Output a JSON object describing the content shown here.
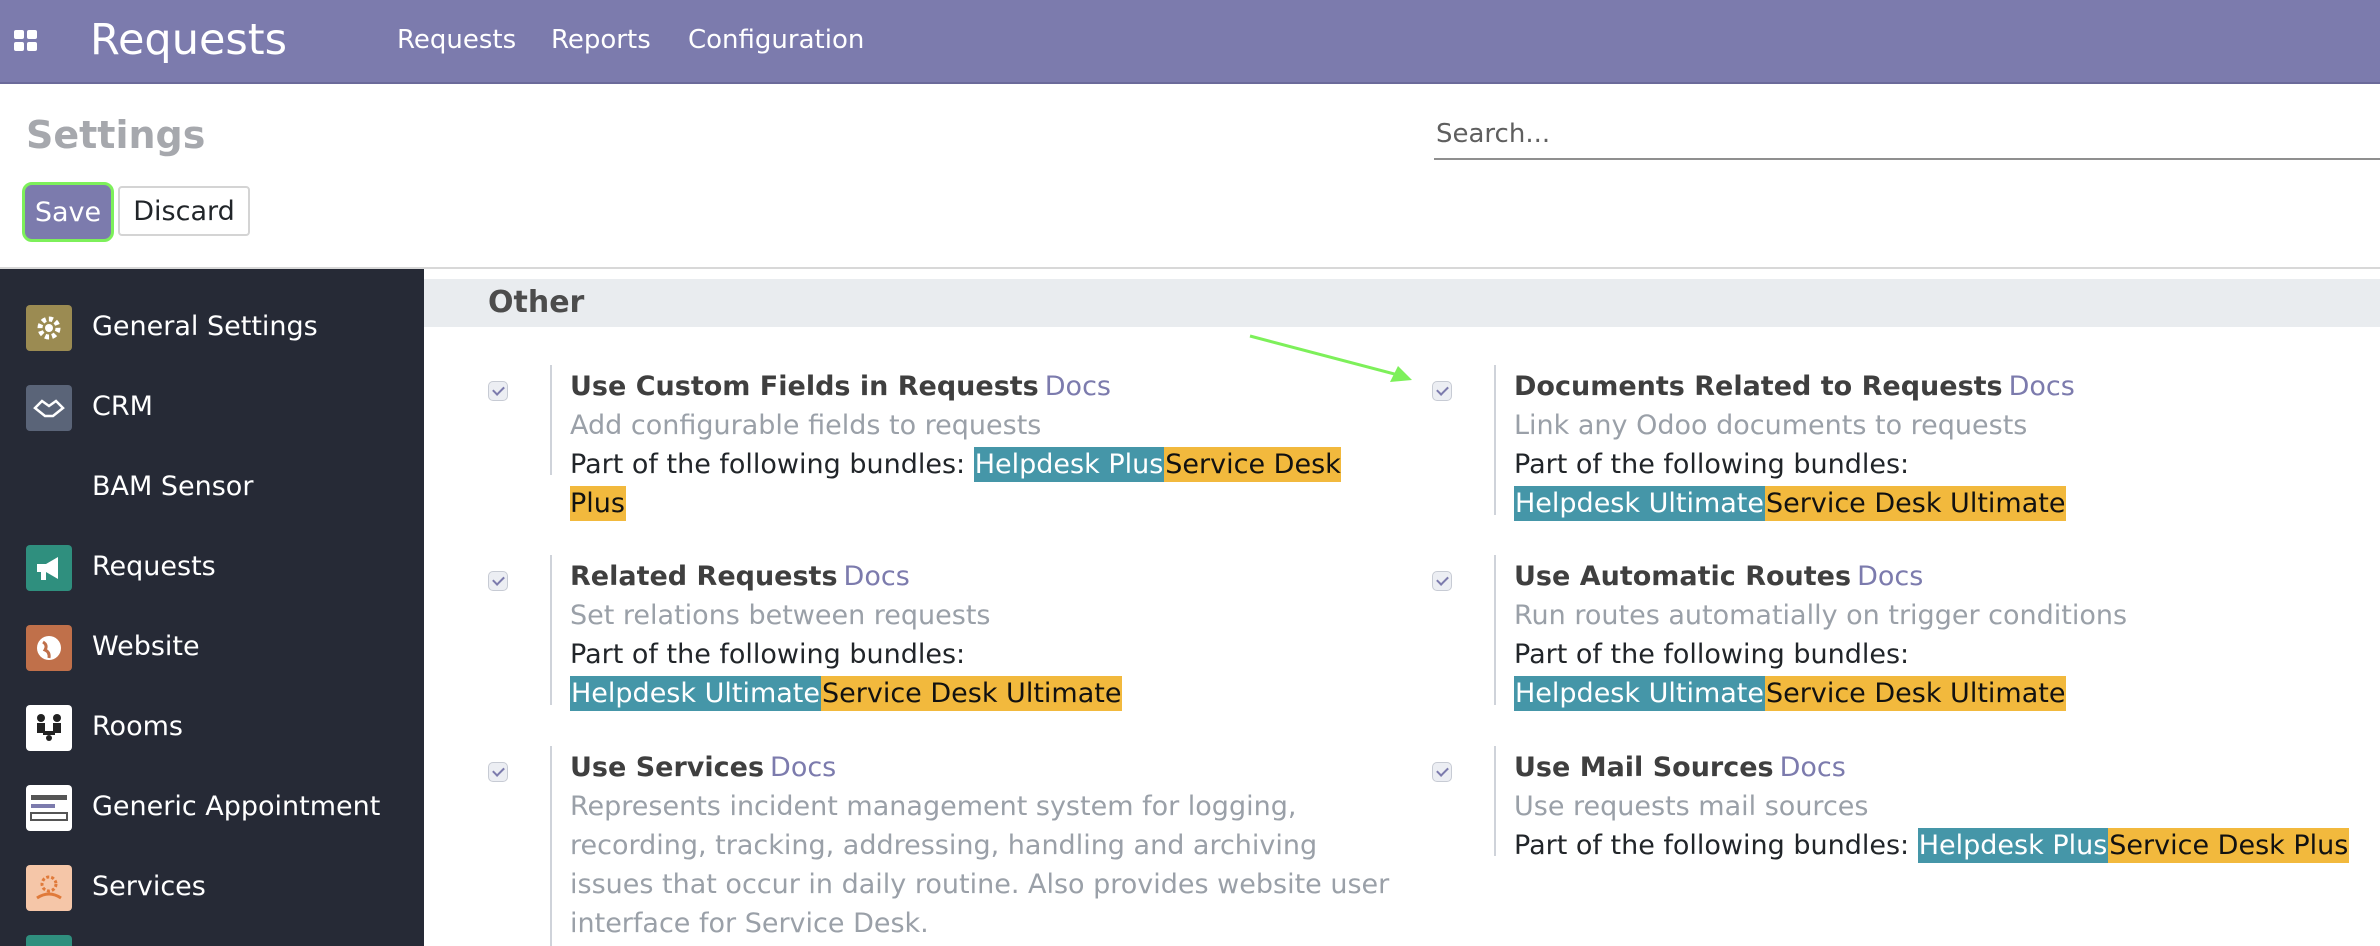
{
  "navbar": {
    "app_title": "Requests",
    "menu": [
      "Requests",
      "Reports",
      "Configuration"
    ],
    "background": "#7c7bad"
  },
  "control_panel": {
    "title": "Settings",
    "search_placeholder": "Search...",
    "save_label": "Save",
    "discard_label": "Discard"
  },
  "sidebar": {
    "items": [
      {
        "label": "General Settings",
        "icon": "gear-icon"
      },
      {
        "label": "CRM",
        "icon": "handshake-icon"
      },
      {
        "label": "BAM Sensor",
        "icon": ""
      },
      {
        "label": "Requests",
        "icon": "megaphone-icon"
      },
      {
        "label": "Website",
        "icon": "globe-icon"
      },
      {
        "label": "Rooms",
        "icon": "people-icon"
      },
      {
        "label": "Generic Appointment",
        "icon": "core-logo-icon"
      },
      {
        "label": "Services",
        "icon": "services-icon"
      }
    ]
  },
  "main": {
    "section_title": "Other",
    "bundle_prefix": "Part of the following bundles:",
    "docs_label": "Docs",
    "settings": [
      {
        "title": "Use Custom Fields in Requests",
        "desc": "Add configurable fields to requests",
        "bundles": [
          "Helpdesk Plus",
          "Service Desk Plus"
        ],
        "checked": true
      },
      {
        "title": "Documents Related to Requests",
        "desc": "Link any Odoo documents to requests",
        "bundles": [
          "Helpdesk Ultimate",
          "Service Desk Ultimate"
        ],
        "checked": true
      },
      {
        "title": "Related Requests",
        "desc": "Set relations between requests",
        "bundles": [
          "Helpdesk Ultimate",
          "Service Desk Ultimate"
        ],
        "checked": true
      },
      {
        "title": "Use Automatic Routes",
        "desc": "Run routes automatially on trigger conditions",
        "bundles": [
          "Helpdesk Ultimate",
          "Service Desk Ultimate"
        ],
        "checked": true
      },
      {
        "title": "Use Services",
        "desc": "Represents incident management system for logging, recording, tracking, addressing, handling and archiving issues that occur in daily routine. Also provides website user interface for Service Desk.",
        "bundles": [],
        "checked": true
      },
      {
        "title": "Use Mail Sources",
        "desc": "Use requests mail sources",
        "bundles": [
          "Helpdesk Plus",
          "Service Desk Plus"
        ],
        "checked": true
      }
    ]
  },
  "colors": {
    "bundle_blue": "#4596a8",
    "bundle_yellow": "#f2b93d",
    "highlight_green": "#7df05a"
  }
}
